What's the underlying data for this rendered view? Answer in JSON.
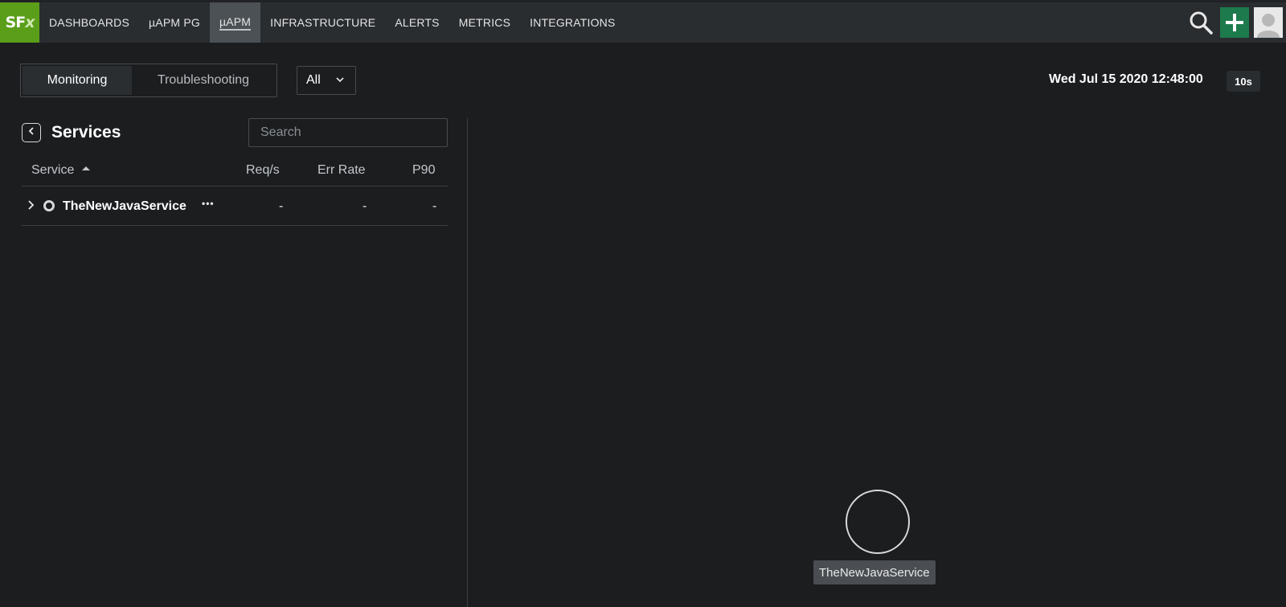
{
  "nav": {
    "logo": "SFx",
    "items": [
      {
        "label": "DASHBOARDS"
      },
      {
        "label": "µAPM PG"
      },
      {
        "label": "µAPM",
        "active": true
      },
      {
        "label": "INFRASTRUCTURE"
      },
      {
        "label": "ALERTS"
      },
      {
        "label": "METRICS"
      },
      {
        "label": "INTEGRATIONS"
      }
    ],
    "icons": [
      "search-icon",
      "plus-icon",
      "user-avatar-icon"
    ],
    "accent": "#5a9e1a",
    "add_color": "#1d7a4c"
  },
  "toolbar": {
    "tabs": [
      {
        "label": "Monitoring",
        "selected": true
      },
      {
        "label": "Troubleshooting",
        "selected": false
      }
    ],
    "env_select": "All",
    "timestamp": "Wed Jul 15 2020 12:48:00",
    "refresh": "10s"
  },
  "services": {
    "title": "Services",
    "search_placeholder": "Search",
    "columns": {
      "service": "Service",
      "req": "Req/s",
      "err": "Err Rate",
      "p90": "P90"
    },
    "rows": [
      {
        "name": "TheNewJavaService",
        "more": "•••",
        "req": "-",
        "err": "-",
        "p90": "-"
      }
    ]
  },
  "map": {
    "nodes": [
      {
        "label": "TheNewJavaService"
      }
    ]
  }
}
